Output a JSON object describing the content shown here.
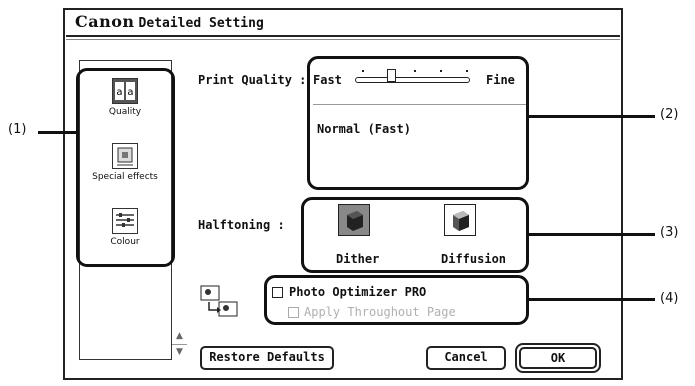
{
  "dialog": {
    "brand": "Canon",
    "title": "Detailed Setting"
  },
  "sidebar": {
    "items": [
      {
        "label": "Quality",
        "icon": "quality-icon"
      },
      {
        "label": "Special effects",
        "icon": "special-effects-icon"
      },
      {
        "label": "Colour",
        "icon": "colour-icon"
      }
    ]
  },
  "print_quality": {
    "label": "Print Quality :",
    "slider_min_label": "Fast",
    "slider_max_label": "Fine",
    "description": "Normal (Fast)"
  },
  "halftoning": {
    "label": "Halftoning :",
    "options": [
      {
        "label": "Dither",
        "icon": "dither-icon"
      },
      {
        "label": "Diffusion",
        "icon": "diffusion-icon"
      }
    ]
  },
  "photo_optimizer": {
    "label": "Photo Optimizer PRO",
    "checked": false,
    "apply_label": "Apply Throughout Page",
    "apply_enabled": false
  },
  "buttons": {
    "restore": "Restore Defaults",
    "cancel": "Cancel",
    "ok": "OK"
  },
  "callouts": {
    "c1": "(1)",
    "c2": "(2)",
    "c3": "(3)",
    "c4": "(4)"
  }
}
